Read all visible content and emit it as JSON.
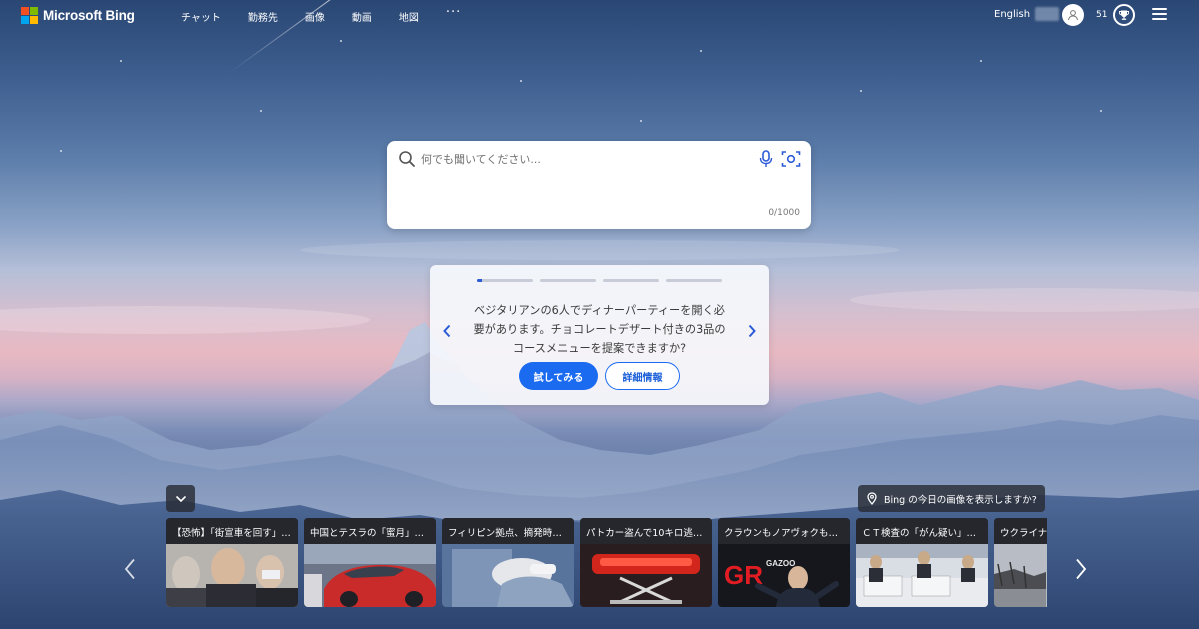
{
  "brand": {
    "name": "Microsoft Bing",
    "logo_colors": [
      "#f25022",
      "#7fba00",
      "#00a4ef",
      "#ffb900"
    ]
  },
  "nav": {
    "items": [
      "チャット",
      "勤務先",
      "画像",
      "動画",
      "地図"
    ],
    "more": "···"
  },
  "account": {
    "language": "English",
    "points": "51"
  },
  "search": {
    "placeholder": "何でも聞いてください...",
    "counter": "0/1000"
  },
  "suggestion": {
    "total_pages": 4,
    "active_page": 1,
    "text": "ベジタリアンの6人でディナーパーティーを開く必要があります。チョコレートデザート付きの3品のコースメニューを提案できますか?",
    "try_label": "試してみる",
    "more_label": "詳細情報"
  },
  "image_of_day": {
    "label": "Bing の今日の画像を表示しますか?"
  },
  "news": [
    {
      "title": "【恐怖】「街宣車を回す」…"
    },
    {
      "title": "中国とテスラの「蜜月」―…"
    },
    {
      "title": "フィリピン拠点、摘発時に…"
    },
    {
      "title": "パトカー盗んで10キロ逃…"
    },
    {
      "title": "クラウンもノアヴォクもプ…"
    },
    {
      "title": "ＣＴ検査の「がん疑い」主…"
    },
    {
      "title": "ウクライナ"
    }
  ],
  "icons": {
    "search": "search-icon",
    "mic": "microphone-icon",
    "visual": "visual-search-icon",
    "prev": "chevron-left-icon",
    "next": "chevron-right-icon",
    "collapse": "chevron-down-icon",
    "location": "location-pin-icon",
    "avatar": "user-avatar-icon",
    "rewards": "rewards-trophy-icon",
    "menu": "hamburger-menu-icon"
  }
}
